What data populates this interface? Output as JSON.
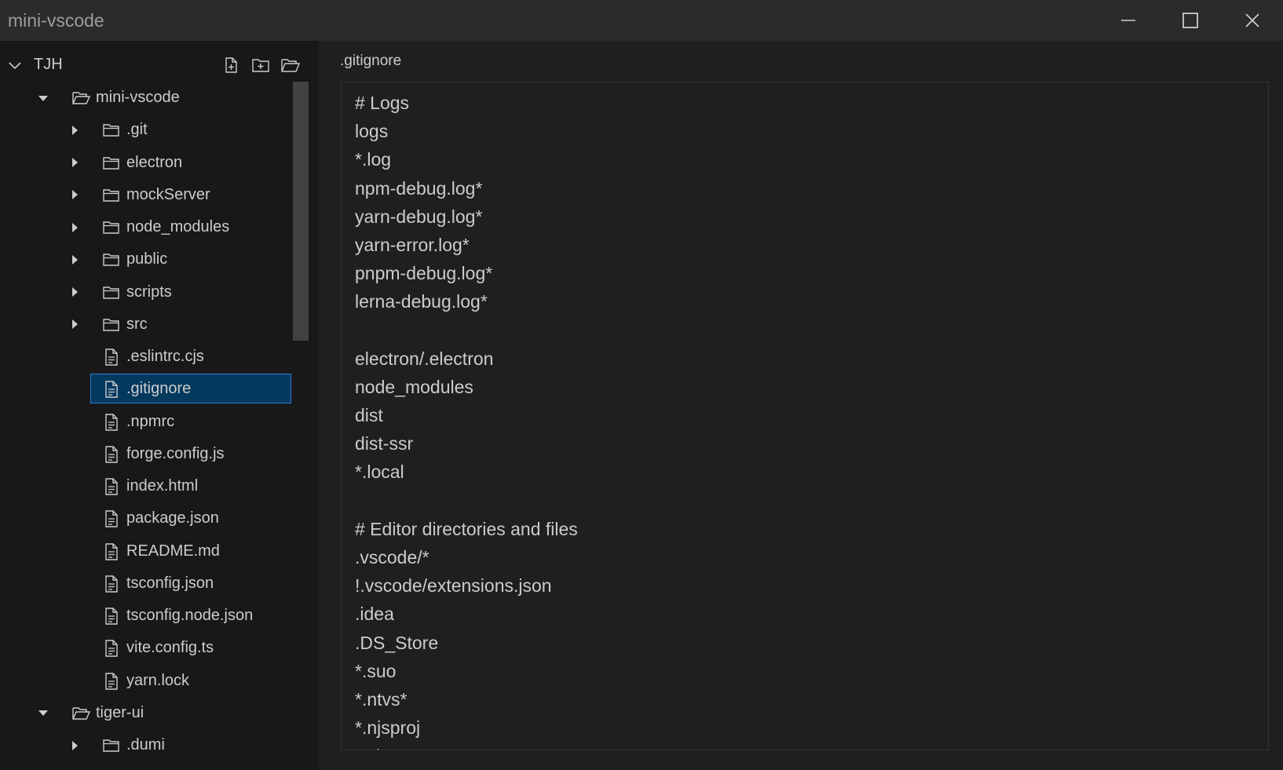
{
  "window": {
    "title": "mini-vscode"
  },
  "explorer": {
    "root_label": "TJH",
    "actions": [
      "new-file",
      "new-folder",
      "open-folder"
    ],
    "items": [
      {
        "label": "mini-vscode",
        "type": "folder",
        "expanded": true,
        "depth": 1
      },
      {
        "label": ".git",
        "type": "folder",
        "expanded": false,
        "depth": 2
      },
      {
        "label": "electron",
        "type": "folder",
        "expanded": false,
        "depth": 2
      },
      {
        "label": "mockServer",
        "type": "folder",
        "expanded": false,
        "depth": 2
      },
      {
        "label": "node_modules",
        "type": "folder",
        "expanded": false,
        "depth": 2
      },
      {
        "label": "public",
        "type": "folder",
        "expanded": false,
        "depth": 2
      },
      {
        "label": "scripts",
        "type": "folder",
        "expanded": false,
        "depth": 2
      },
      {
        "label": "src",
        "type": "folder",
        "expanded": false,
        "depth": 2
      },
      {
        "label": ".eslintrc.cjs",
        "type": "file",
        "depth": 2
      },
      {
        "label": ".gitignore",
        "type": "file",
        "depth": 2,
        "selected": true
      },
      {
        "label": ".npmrc",
        "type": "file",
        "depth": 2
      },
      {
        "label": "forge.config.js",
        "type": "file",
        "depth": 2
      },
      {
        "label": "index.html",
        "type": "file",
        "depth": 2
      },
      {
        "label": "package.json",
        "type": "file",
        "depth": 2
      },
      {
        "label": "README.md",
        "type": "file",
        "depth": 2
      },
      {
        "label": "tsconfig.json",
        "type": "file",
        "depth": 2
      },
      {
        "label": "tsconfig.node.json",
        "type": "file",
        "depth": 2
      },
      {
        "label": "vite.config.ts",
        "type": "file",
        "depth": 2
      },
      {
        "label": "yarn.lock",
        "type": "file",
        "depth": 2
      },
      {
        "label": "tiger-ui",
        "type": "folder",
        "expanded": true,
        "depth": 1
      },
      {
        "label": ".dumi",
        "type": "folder",
        "expanded": false,
        "depth": 2
      }
    ]
  },
  "editor": {
    "file_title": ".gitignore",
    "lines": [
      "# Logs",
      "logs",
      "*.log",
      "npm-debug.log*",
      "yarn-debug.log*",
      "yarn-error.log*",
      "pnpm-debug.log*",
      "lerna-debug.log*",
      "",
      "electron/.electron",
      "node_modules",
      "dist",
      "dist-ssr",
      "*.local",
      "",
      "# Editor directories and files",
      ".vscode/*",
      "!.vscode/extensions.json",
      ".idea",
      ".DS_Store",
      "*.suo",
      "*.ntvs*",
      "*.njsproj",
      "*.sln"
    ]
  },
  "colors": {
    "titlebar_bg": "#2b2b2b",
    "sidebar_bg": "#181818",
    "editor_bg": "#1f1f1f",
    "selection_bg": "#04395e",
    "selection_border": "#2f7bd8",
    "text": "#cccccc"
  }
}
